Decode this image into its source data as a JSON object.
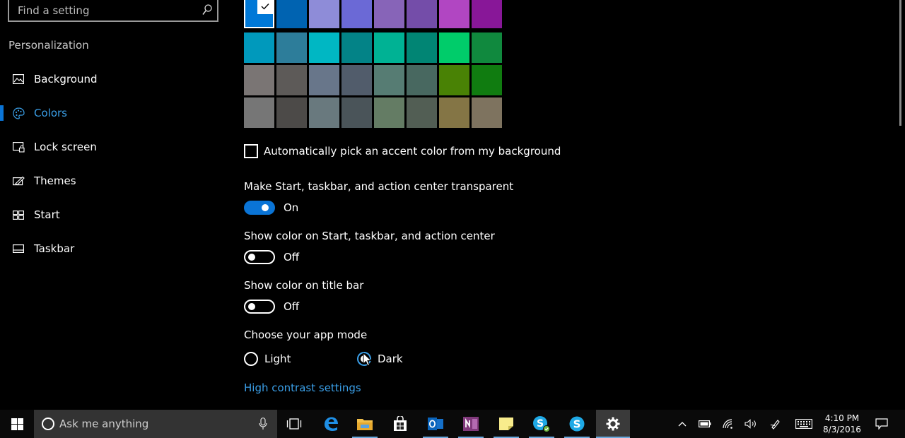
{
  "search": {
    "placeholder": "Find a setting"
  },
  "sidebar": {
    "section_title": "Personalization",
    "items": [
      {
        "label": "Background",
        "icon": "picture-icon"
      },
      {
        "label": "Colors",
        "icon": "palette-icon",
        "active": true
      },
      {
        "label": "Lock screen",
        "icon": "lock-screen-icon"
      },
      {
        "label": "Themes",
        "icon": "themes-icon"
      },
      {
        "label": "Start",
        "icon": "start-icon"
      },
      {
        "label": "Taskbar",
        "icon": "taskbar-icon"
      }
    ]
  },
  "accent_colors": {
    "selected": "#0078d7",
    "rows": [
      [
        "#0078d7",
        "#0063b1",
        "#8e8cd8",
        "#6b69d6",
        "#8764b8",
        "#744da9",
        "#b146c2",
        "#881798"
      ],
      [
        "#0099bc",
        "#2d7d9a",
        "#00b7c3",
        "#038387",
        "#00b294",
        "#018574",
        "#00cc6a",
        "#10893e"
      ],
      [
        "#7a7574",
        "#5d5a58",
        "#68768a",
        "#515c6b",
        "#567c73",
        "#486860",
        "#498205",
        "#107c10"
      ],
      [
        "#767676",
        "#4c4a48",
        "#69797e",
        "#4a5459",
        "#647c64",
        "#525e54",
        "#847545",
        "#7e735f"
      ]
    ]
  },
  "auto_pick": {
    "label": "Automatically pick an accent color from my background",
    "checked": false
  },
  "transparent": {
    "label": "Make Start, taskbar, and action center transparent",
    "state": "On"
  },
  "show_color_start": {
    "label": "Show color on Start, taskbar, and action center",
    "state": "Off"
  },
  "show_color_title": {
    "label": "Show color on title bar",
    "state": "Off"
  },
  "app_mode": {
    "label": "Choose your app mode",
    "light": "Light",
    "dark": "Dark",
    "selected": "Dark"
  },
  "high_contrast_link": "High contrast settings",
  "taskbar": {
    "cortana_placeholder": "Ask me anything",
    "apps": [
      "task-view-icon",
      "edge-icon",
      "file-explorer-icon",
      "store-icon",
      "outlook-icon",
      "onenote-icon",
      "sticky-notes-icon",
      "skype-business-icon",
      "skype-icon",
      "settings-gear-icon"
    ],
    "time": "4:10 PM",
    "date": "8/3/2016"
  },
  "colors": {
    "accent": "#0a74d6",
    "link": "#3a9ee6"
  }
}
